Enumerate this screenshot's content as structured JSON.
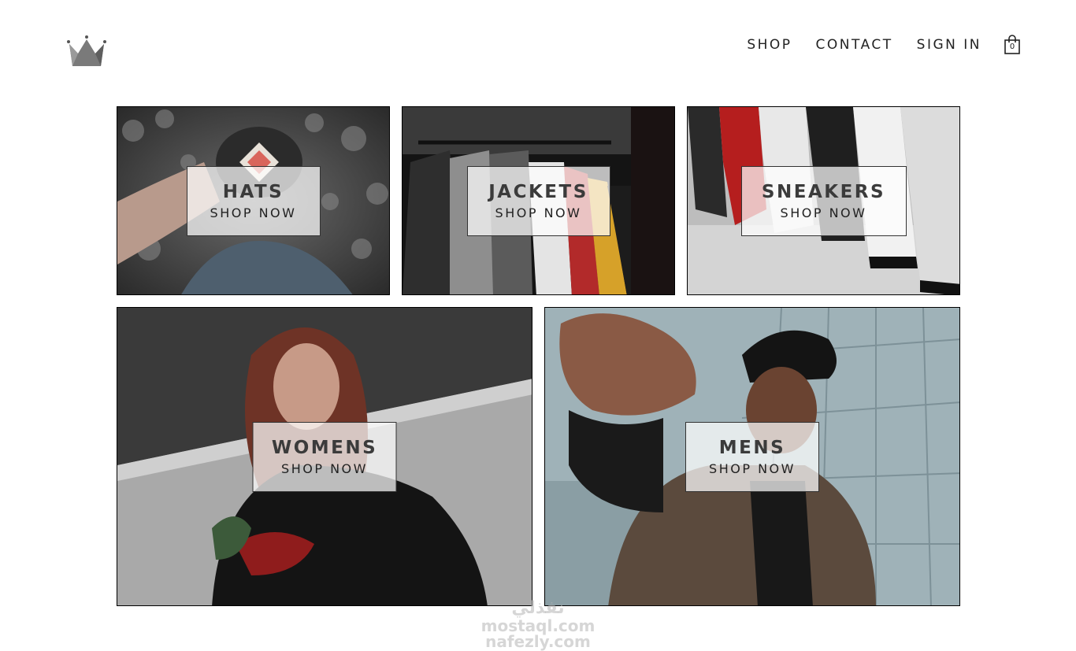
{
  "header": {
    "logo": "crown-icon",
    "nav": {
      "shop": "SHOP",
      "contact": "CONTACT",
      "sign_in": "SIGN IN"
    },
    "cart": {
      "icon": "shopping-bag-icon",
      "count": "0"
    }
  },
  "directory": [
    {
      "title": "HATS",
      "cta": "SHOP NOW",
      "photo": "person-wearing-cap-photo"
    },
    {
      "title": "JACKETS",
      "cta": "SHOP NOW",
      "photo": "clothing-rack-photo"
    },
    {
      "title": "SNEAKERS",
      "cta": "SHOP NOW",
      "photo": "sneakers-row-photo"
    },
    {
      "title": "WOMENS",
      "cta": "SHOP NOW",
      "photo": "woman-portrait-photo"
    },
    {
      "title": "MENS",
      "cta": "SHOP NOW",
      "photo": "man-reaching-photo"
    }
  ],
  "watermark": {
    "line1": "نفذلي",
    "line2": "mostaql.com",
    "line3": "nafezly.com"
  }
}
